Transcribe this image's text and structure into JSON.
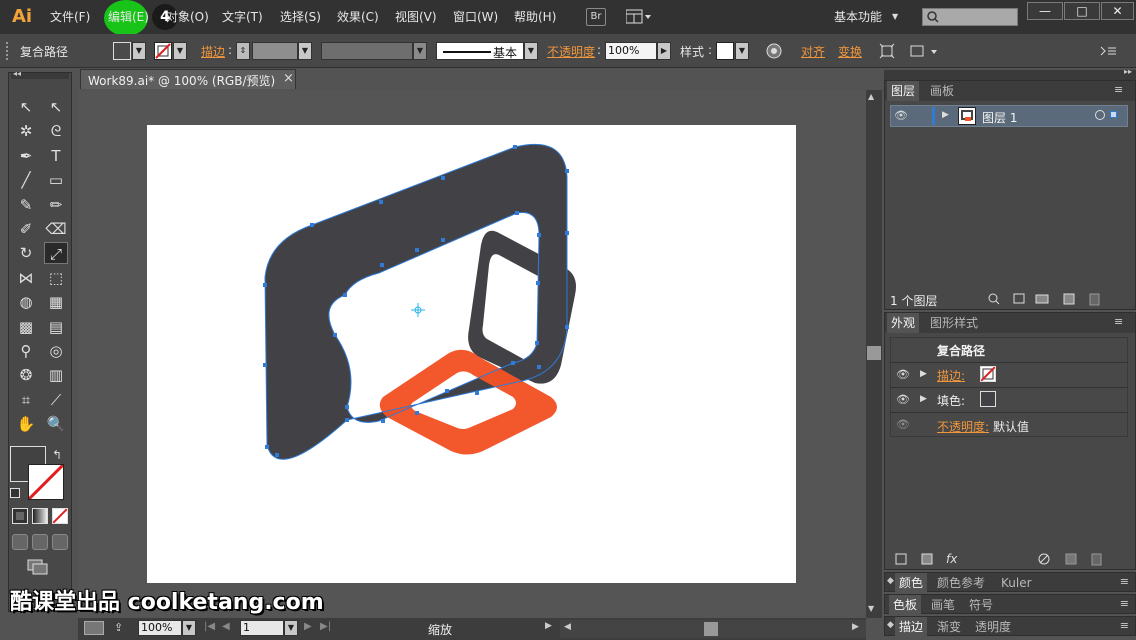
{
  "app": {
    "logo": "Ai",
    "menus": [
      "文件(F)",
      "编辑(E)",
      "对象(O)",
      "文字(T)",
      "选择(S)",
      "效果(C)",
      "视图(V)",
      "窗口(W)",
      "帮助(H)"
    ],
    "br_button": "Br",
    "workspace": "基本功能",
    "step_number": "4",
    "window_controls": [
      "—",
      "□",
      "✕"
    ]
  },
  "control_bar": {
    "selection_type": "复合路径",
    "stroke_label": "描边",
    "stroke_style": "基本",
    "opacity_label": "不透明度",
    "opacity_value": "100%",
    "style_label": "样式",
    "align_label": "对齐",
    "transform_label": "变换"
  },
  "document": {
    "tab_title": "Work89.ai* @ 100% (RGB/预览)",
    "close_glyph": "×"
  },
  "status_bar": {
    "zoom": "100%",
    "page": "1",
    "tool_name": "缩放"
  },
  "layers_panel": {
    "tabs": [
      "图层",
      "画板"
    ],
    "layer_name": "图层 1",
    "count_label": "1 个图层"
  },
  "appearance_panel": {
    "tabs": [
      "外观",
      "图形样式"
    ],
    "object_type": "复合路径",
    "stroke_label": "描边:",
    "fill_label": "填色:",
    "opacity_label": "不透明度:",
    "opacity_value": "默认值",
    "fx_label": "fx"
  },
  "collapsed_panels": [
    [
      "颜色",
      "颜色参考",
      "Kuler"
    ],
    [
      "色板",
      "画笔",
      "符号"
    ],
    [
      "描边",
      "渐变",
      "透明度"
    ]
  ],
  "watermark": "酷课堂出品 coolketang.com",
  "colors": {
    "shape_dark": "#424246",
    "shape_orange": "#f25324",
    "selection_blue": "#2f7bd9",
    "link_orange": "#f0963b"
  }
}
